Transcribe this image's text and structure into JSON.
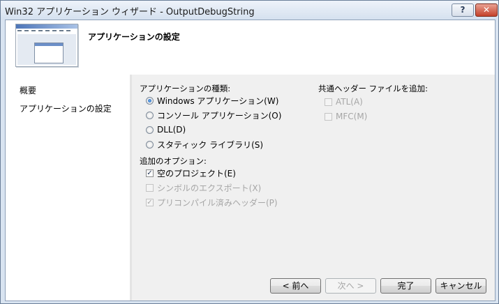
{
  "window": {
    "title": "Win32 アプリケーション ウィザード - OutputDebugString",
    "help_label": "?",
    "close_label": "✕"
  },
  "header": {
    "title": "アプリケーションの設定"
  },
  "nav": {
    "items": [
      {
        "label": "概要"
      },
      {
        "label": "アプリケーションの設定"
      }
    ]
  },
  "app_type": {
    "heading": "アプリケーションの種類:",
    "options": [
      {
        "label": "Windows アプリケーション(W)",
        "selected": true
      },
      {
        "label": "コンソール アプリケーション(O)",
        "selected": false
      },
      {
        "label": "DLL(D)",
        "selected": false
      },
      {
        "label": "スタティック ライブラリ(S)",
        "selected": false
      }
    ]
  },
  "additional": {
    "heading": "追加のオプション:",
    "options": [
      {
        "label": "空のプロジェクト(E)",
        "checked": true,
        "enabled": true
      },
      {
        "label": "シンボルのエクスポート(X)",
        "checked": false,
        "enabled": false
      },
      {
        "label": "プリコンパイル済みヘッダー(P)",
        "checked": true,
        "enabled": false
      }
    ]
  },
  "common_headers": {
    "heading": "共通ヘッダー ファイルを追加:",
    "options": [
      {
        "label": "ATL(A)",
        "checked": false,
        "enabled": false
      },
      {
        "label": "MFC(M)",
        "checked": false,
        "enabled": false
      }
    ]
  },
  "buttons": {
    "prev": "< 前へ",
    "next": "次へ >",
    "finish": "完了",
    "cancel": "キャンセル"
  },
  "colors": {
    "accent": "#1f5fb7",
    "disabled_text": "#a6a6a6",
    "close": "#c4412a"
  }
}
